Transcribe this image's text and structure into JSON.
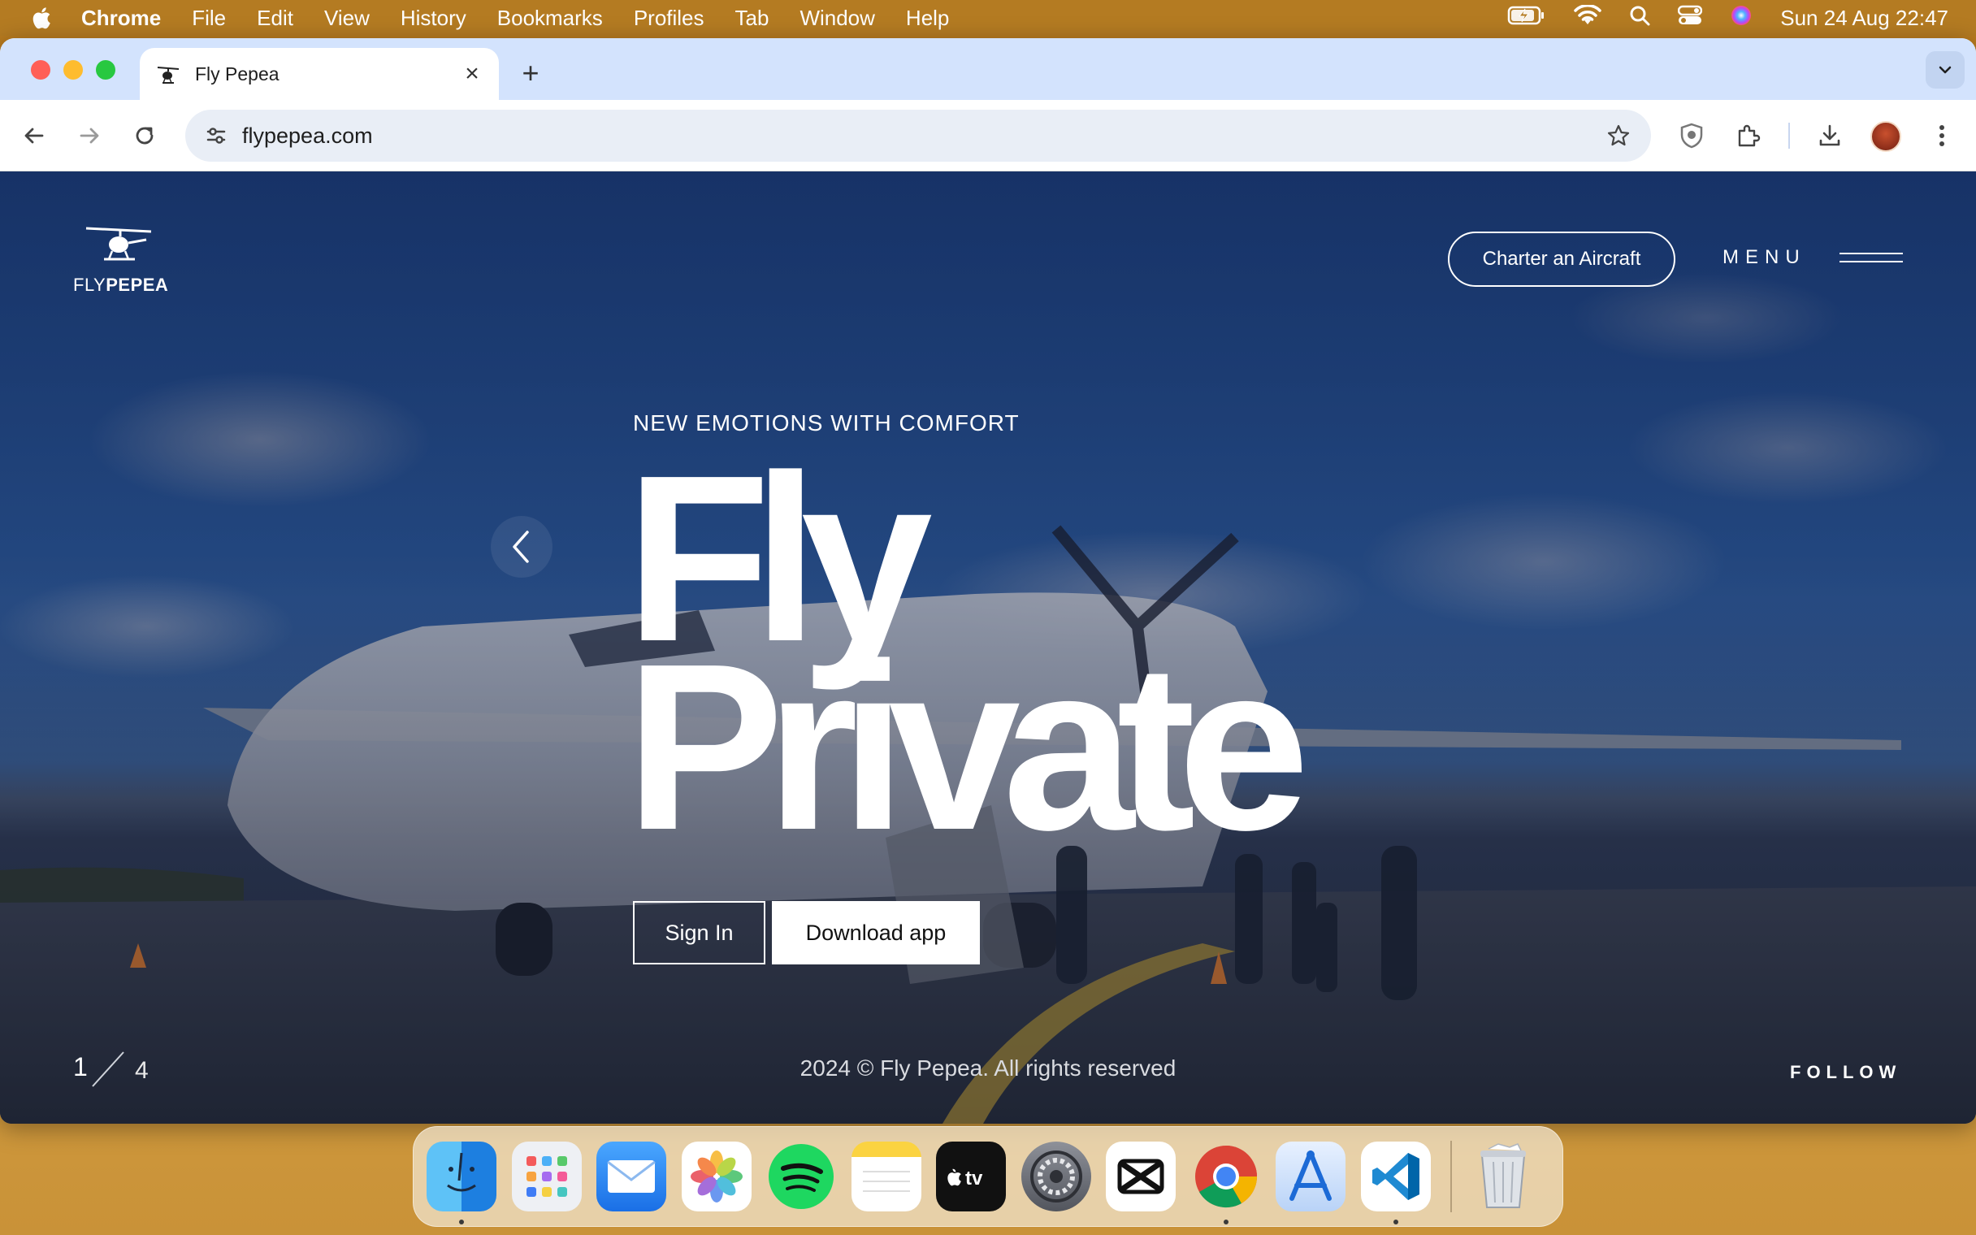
{
  "menubar": {
    "app_name": "Chrome",
    "items": [
      "File",
      "Edit",
      "View",
      "History",
      "Bookmarks",
      "Profiles",
      "Tab",
      "Window",
      "Help"
    ],
    "clock": "Sun 24 Aug  22:47"
  },
  "browser": {
    "tab_title": "Fly Pepea",
    "url": "flypepea.com"
  },
  "site": {
    "logo_text_light": "FLY",
    "logo_text_bold": "PEPEA",
    "charter_label": "Charter an Aircraft",
    "menu_label": "MENU",
    "kicker": "NEW EMOTIONS WITH COMFORT",
    "hero_line1": "Fly",
    "hero_line2": "Private",
    "signin_label": "Sign In",
    "download_label": "Download app",
    "slide_current": "1",
    "slide_total": "4",
    "copyright": "2024 © Fly Pepea. All rights reserved",
    "follow_label": "FOLLOW"
  },
  "dock": {
    "apps": [
      "Finder",
      "Launchpad",
      "Mail",
      "Photos",
      "Spotify",
      "Notes",
      "Apple TV",
      "System Settings",
      "CapCut",
      "Chrome",
      "Xcode Instruments",
      "Visual Studio Code",
      "Trash"
    ]
  },
  "colors": {
    "menubar": "#b47b22",
    "tabstrip": "#d3e3fd",
    "omnibox": "#e9eef6"
  }
}
